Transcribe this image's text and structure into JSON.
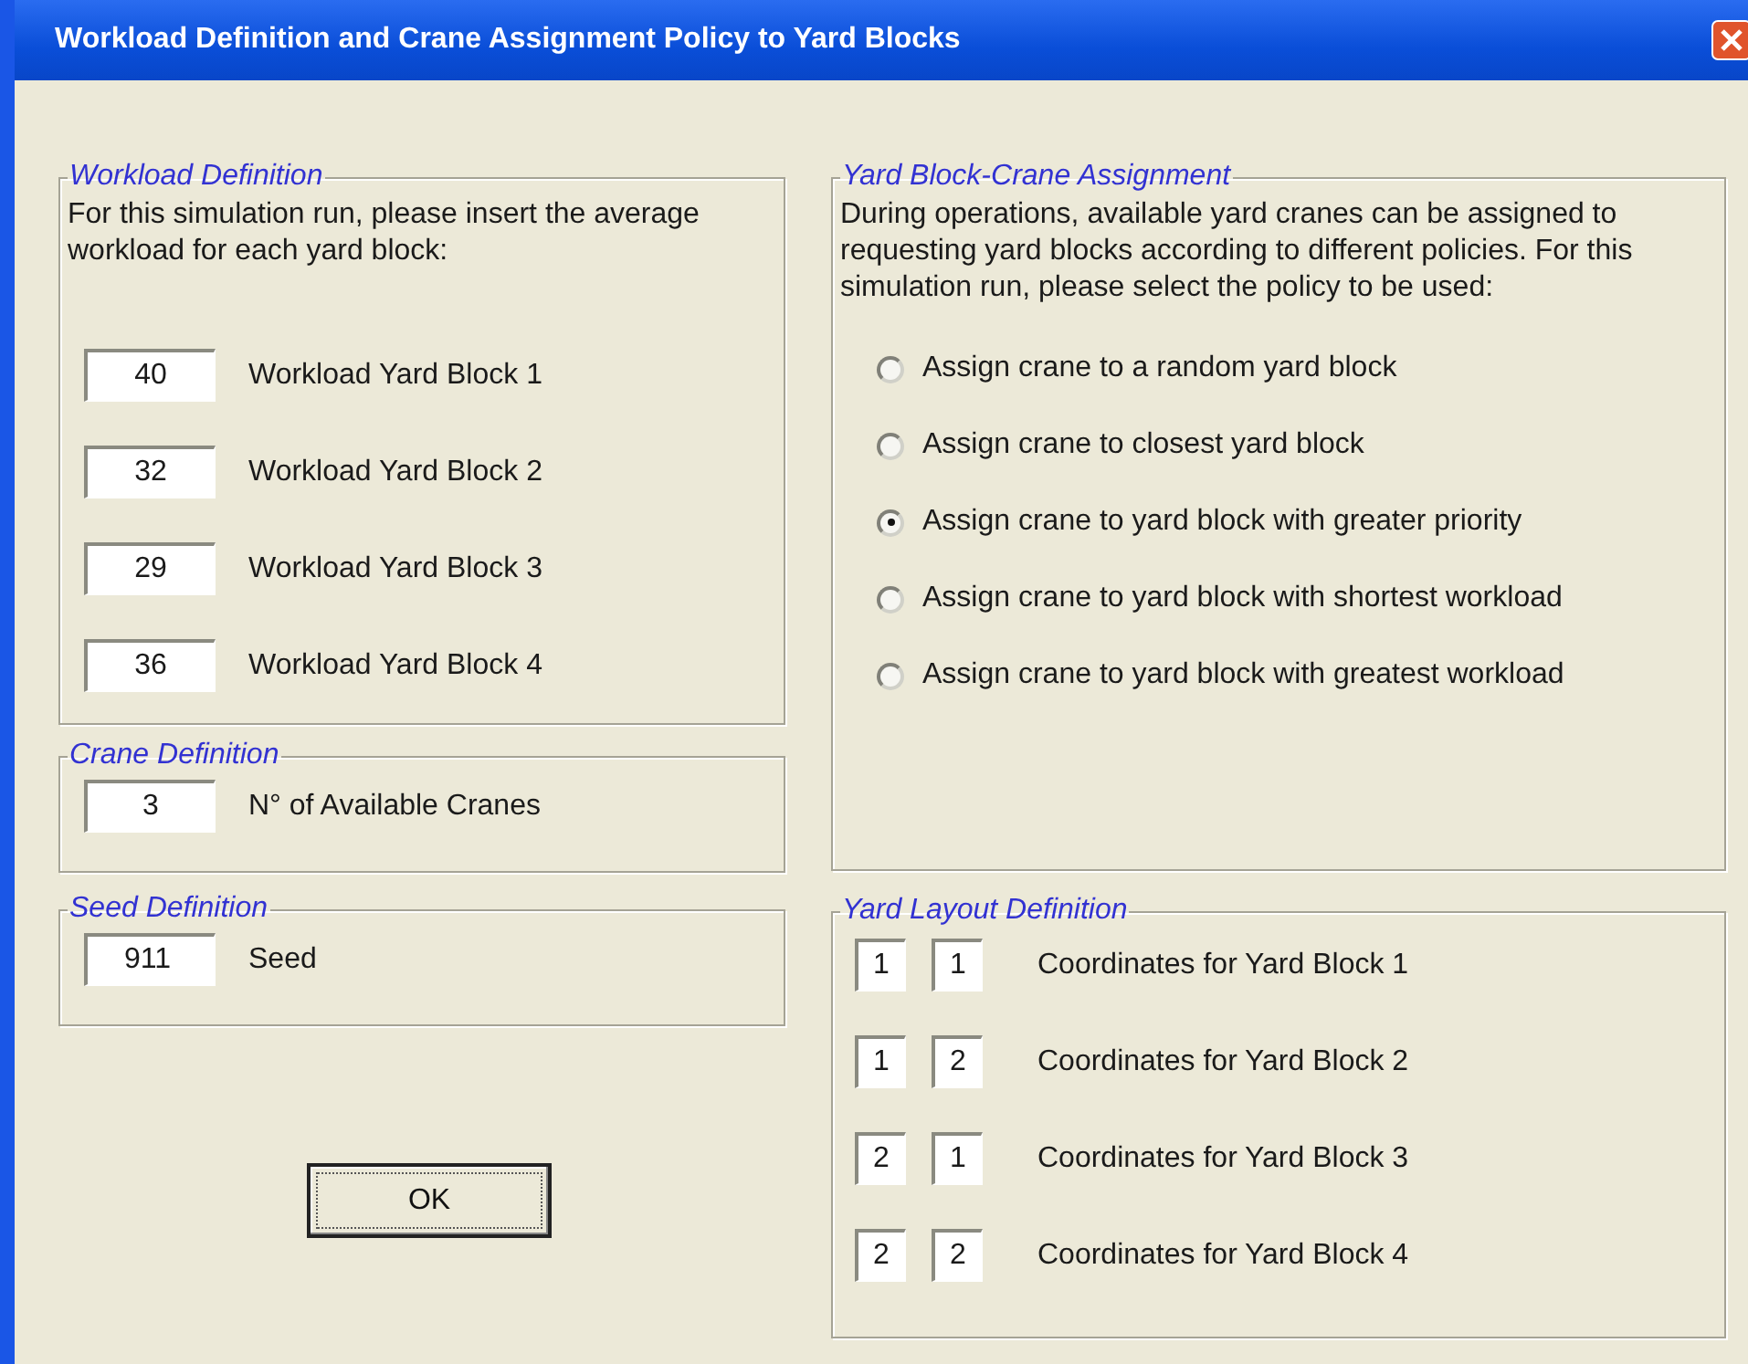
{
  "window": {
    "title": "Workload Definition and Crane Assignment Policy to Yard Blocks"
  },
  "workload_definition": {
    "legend": "Workload Definition",
    "instructions": "For this simulation run, please insert the average workload for each yard block:",
    "blocks": [
      {
        "value": "40",
        "label": "Workload Yard Block 1"
      },
      {
        "value": "32",
        "label": "Workload Yard Block 2"
      },
      {
        "value": "29",
        "label": "Workload Yard Block 3"
      },
      {
        "value": "36",
        "label": "Workload Yard Block 4"
      }
    ]
  },
  "crane_definition": {
    "legend": "Crane Definition",
    "value": "3",
    "label": "N° of Available Cranes"
  },
  "seed_definition": {
    "legend": "Seed Definition",
    "value": "911",
    "label": "Seed"
  },
  "buttons": [
    "OK"
  ],
  "assignment": {
    "legend": "Yard Block-Crane Assignment",
    "instructions": "During operations, available yard cranes can be assigned to requesting yard blocks according to different policies. For this simulation run, please select the policy to be used:",
    "policies": [
      {
        "label": "Assign crane to a random yard block",
        "selected": false
      },
      {
        "label": "Assign crane to closest yard block",
        "selected": false
      },
      {
        "label": "Assign crane to yard block with greater priority",
        "selected": true
      },
      {
        "label": "Assign crane to yard block with shortest workload",
        "selected": false
      },
      {
        "label": "Assign crane to yard block with greatest workload",
        "selected": false
      }
    ]
  },
  "yard_layout": {
    "legend": "Yard Layout Definition",
    "blocks": [
      {
        "row": "1",
        "column": "1",
        "label": "Coordinates for Yard Block 1"
      },
      {
        "row": "1",
        "column": "2",
        "label": "Coordinates for Yard Block 2"
      },
      {
        "row": "2",
        "column": "1",
        "label": "Coordinates for Yard Block 3"
      },
      {
        "row": "2",
        "column": "2",
        "label": "Coordinates for Yard Block 4"
      }
    ]
  }
}
